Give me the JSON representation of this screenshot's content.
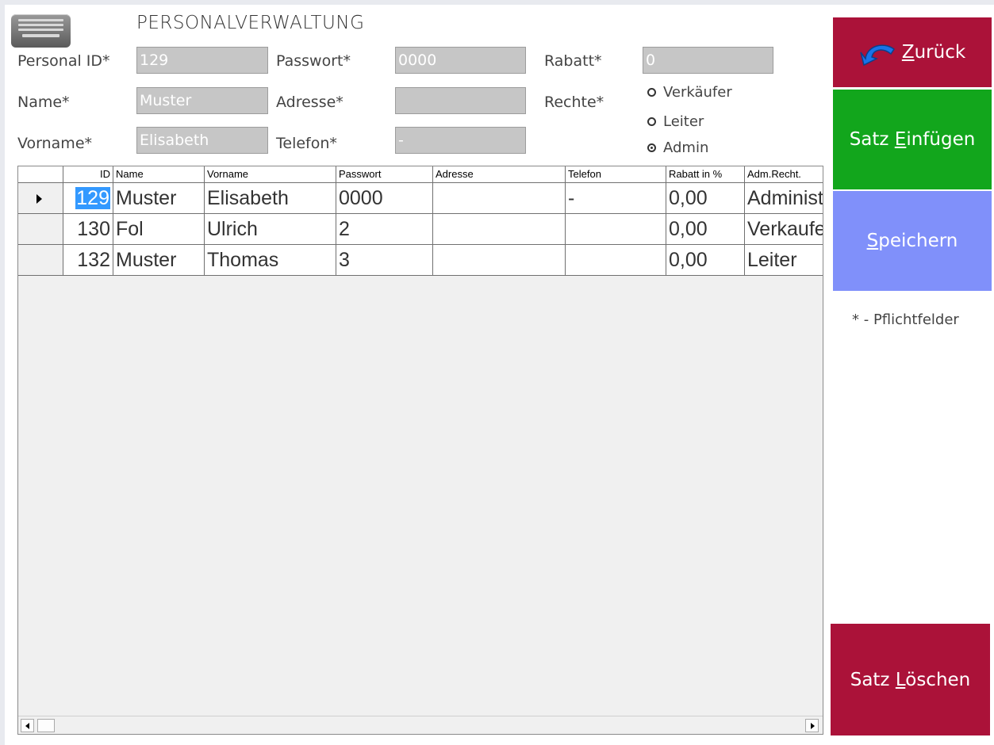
{
  "header": {
    "title": "PERSONALVERWALTUNG",
    "keyboard_icon": "keyboard-icon"
  },
  "form": {
    "personal_id": {
      "label": "Personal ID*",
      "value": "129"
    },
    "passwort": {
      "label": "Passwort*",
      "value": "0000"
    },
    "rabatt": {
      "label": "Rabatt*",
      "value": "0"
    },
    "name": {
      "label": "Name*",
      "value": "Muster"
    },
    "adresse": {
      "label": "Adresse*",
      "value": ""
    },
    "rechte": {
      "label": "Rechte*",
      "options": [
        "Verkäufer",
        "Leiter",
        "Admin"
      ],
      "selected": "Admin"
    },
    "vorname": {
      "label": "Vorname*",
      "value": "Elisabeth"
    },
    "telefon": {
      "label": "Telefon*",
      "value": "-"
    }
  },
  "table": {
    "columns": [
      "ID",
      "Name",
      "Vorname",
      "Passwort",
      "Adresse",
      "Telefon",
      "Rabatt in %",
      "Adm.Recht."
    ],
    "rows": [
      {
        "id": "129",
        "name": "Muster",
        "vorname": "Elisabeth",
        "passwort": "0000",
        "adresse": "",
        "telefon": "-",
        "rabatt": "0,00",
        "recht": "Administrator"
      },
      {
        "id": "130",
        "name": "Fol",
        "vorname": "Ulrich",
        "passwort": "2",
        "adresse": "",
        "telefon": "",
        "rabatt": "0,00",
        "recht": "Verkaufer"
      },
      {
        "id": "132",
        "name": "Muster",
        "vorname": "Thomas",
        "passwort": "3",
        "adresse": "",
        "telefon": "",
        "rabatt": "0,00",
        "recht": "Leiter"
      }
    ],
    "selected_row_indicator": "row-pointer-icon"
  },
  "buttons": {
    "zurueck": {
      "mnemonic": "Z",
      "rest": "urück",
      "color": "#ab1239",
      "icon": "back-arrow-icon"
    },
    "einfuegen": {
      "prefix": "Satz ",
      "mnemonic": "E",
      "rest": "infügen",
      "color": "#12a61c"
    },
    "speichern": {
      "mnemonic": "S",
      "rest": "peichern",
      "color": "#8090fa"
    },
    "loeschen": {
      "prefix": "Satz ",
      "mnemonic": "L",
      "rest": "öschen",
      "color": "#ab1239"
    }
  },
  "note": "* - Pflichtfelder"
}
